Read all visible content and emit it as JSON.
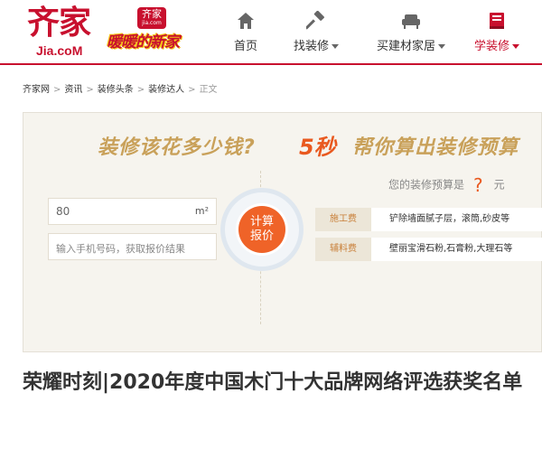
{
  "logo": {
    "cn": "齐家",
    "en": "Jia.coM"
  },
  "badge": {
    "top": "齐家",
    "top_small": "jia.com",
    "main": "暖暖的新家"
  },
  "nav": [
    {
      "label": "首页",
      "icon": "home-icon",
      "dropdown": false
    },
    {
      "label": "找装修",
      "icon": "hammer-icon",
      "dropdown": true
    },
    {
      "label": "买建材家居",
      "icon": "sofa-icon",
      "dropdown": true
    },
    {
      "label": "学装修",
      "icon": "book-icon",
      "dropdown": true,
      "active": true
    }
  ],
  "breadcrumb": [
    "齐家网",
    "资讯",
    "装修头条",
    "装修达人",
    "正文"
  ],
  "calculator": {
    "title_left": "装修该花多少钱?",
    "title_highlight": "5秒",
    "title_right": "帮你算出装修预算",
    "area_value": "80",
    "area_unit": "m²",
    "phone_placeholder": "输入手机号码，获取报价结果",
    "button_line1": "计算",
    "button_line2": "报价",
    "budget_label": "您的装修预算是",
    "budget_value": "?",
    "budget_unit": "元",
    "rows": [
      {
        "tag": "施工费",
        "desc": "铲除墙面腻子层，滚筒,砂皮等"
      },
      {
        "tag": "辅料费",
        "desc": "壁丽宝滑石粉,石膏粉,大理石等"
      }
    ]
  },
  "article": {
    "title": "荣耀时刻|2020年度中国木门十大品牌网络评选获奖名单"
  },
  "colors": {
    "brand_red": "#c8102e",
    "accent_orange": "#ef6328",
    "gold": "#c9a15a"
  }
}
